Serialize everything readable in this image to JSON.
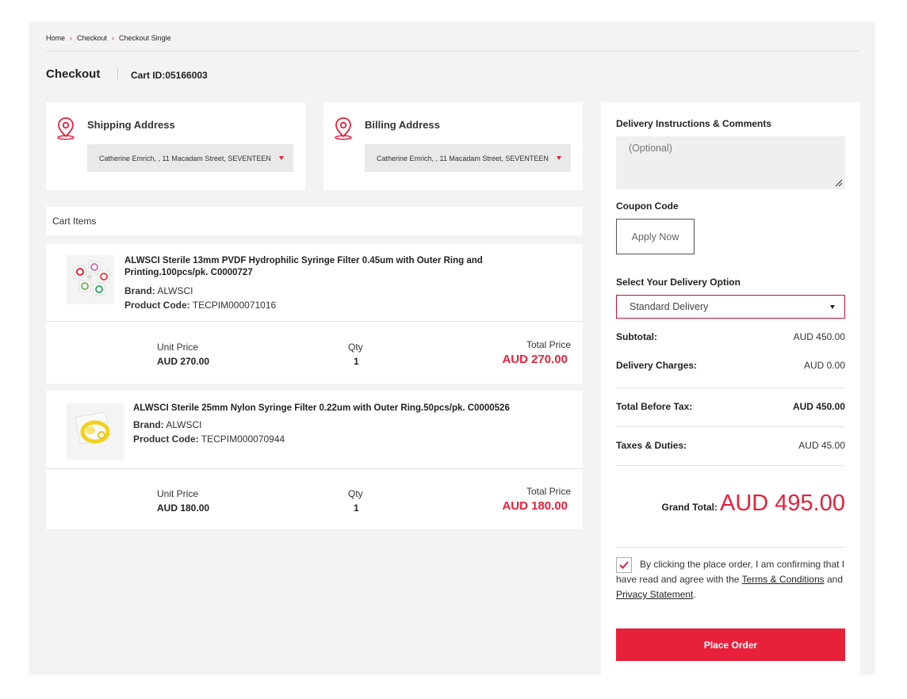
{
  "breadcrumb": [
    "Home",
    "Checkout",
    "Checkout Single"
  ],
  "page_title": "Checkout",
  "cart_id": "Cart ID:05166003",
  "shipping": {
    "title": "Shipping Address",
    "value": "Catherine Emrich, , 11 Macadam Street, SEVENTEEN"
  },
  "billing": {
    "title": "Billing Address",
    "value": "Catherine Emrich, , 11 Macadam Street, SEVENTEEN"
  },
  "cart_items_header": "Cart Items",
  "labels": {
    "brand": "Brand:",
    "product_code": "Product Code:",
    "unit_price": "Unit Price",
    "qty": "Qty",
    "total_price": "Total Price"
  },
  "items": [
    {
      "name": "ALWSCI Sterile 13mm PVDF Hydrophilic Syringe Filter 0.45um with Outer Ring and Printing.100pcs/pk. C0000727",
      "brand": "ALWSCI",
      "code": "TECPIM000071016",
      "unit_price": "AUD 270.00",
      "qty": "1",
      "total": "AUD 270.00"
    },
    {
      "name": "ALWSCI Sterile 25mm Nylon Syringe Filter 0.22um with Outer Ring.50pcs/pk. C0000526",
      "brand": "ALWSCI",
      "code": "TECPIM000070944",
      "unit_price": "AUD 180.00",
      "qty": "1",
      "total": "AUD 180.00"
    }
  ],
  "sidebar": {
    "comments_label": "Delivery Instructions & Comments",
    "comments_placeholder": "(Optional)",
    "coupon_label": "Coupon Code",
    "coupon_button": "Apply Now",
    "delivery_label": "Select Your Delivery Option",
    "delivery_value": "Standard Delivery",
    "subtotal_label": "Subtotal:",
    "subtotal": "AUD 450.00",
    "delivery_charges_label": "Delivery Charges:",
    "delivery_charges": "AUD 0.00",
    "before_tax_label": "Total Before Tax:",
    "before_tax": "AUD 450.00",
    "taxes_label": "Taxes & Duties:",
    "taxes": "AUD 45.00",
    "grand_total_label": "Grand Total:",
    "grand_total": "AUD 495.00",
    "agree_prefix": "By clicking the place order, I am confirming that I have read and agree with the",
    "terms_link": "Terms & Conditions",
    "agree_and": "and",
    "privacy_link": "Privacy Statement",
    "agree_suffix": ".",
    "agree_checked": true,
    "place_order": "Place Order"
  },
  "colors": {
    "accent": "#e8203a",
    "page_bg": "#f3f3f3"
  }
}
